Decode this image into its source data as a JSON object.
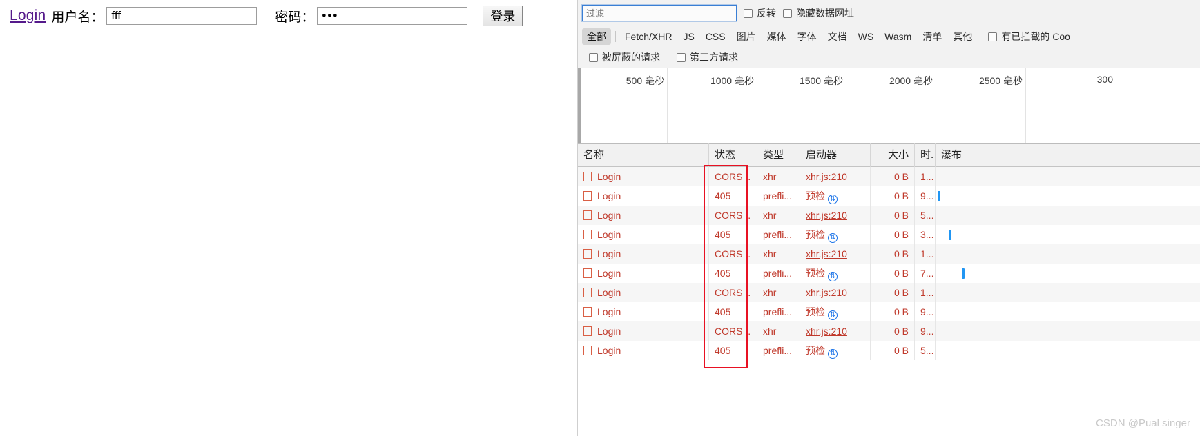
{
  "page": {
    "login_link": "Login",
    "username_label": "用户名：",
    "username_value": "fff",
    "username_placeholder": "",
    "password_label": "密码：",
    "password_value": "•••",
    "password_placeholder": "",
    "login_button": "登录"
  },
  "devtools": {
    "filter": {
      "placeholder": "过滤",
      "value": "",
      "invert_label": "反转",
      "hide_data_urls_label": "隐藏数据网址"
    },
    "type_filters": [
      {
        "label": "全部",
        "active": true
      },
      {
        "label": "Fetch/XHR",
        "active": false
      },
      {
        "label": "JS",
        "active": false
      },
      {
        "label": "CSS",
        "active": false
      },
      {
        "label": "图片",
        "active": false
      },
      {
        "label": "媒体",
        "active": false
      },
      {
        "label": "字体",
        "active": false
      },
      {
        "label": "文档",
        "active": false
      },
      {
        "label": "WS",
        "active": false
      },
      {
        "label": "Wasm",
        "active": false
      },
      {
        "label": "清单",
        "active": false
      },
      {
        "label": "其他",
        "active": false
      }
    ],
    "blocked_cookies_label": "有已拦截的 Coo",
    "blocked_requests_label": "被屏蔽的请求",
    "third_party_label": "第三方请求",
    "timeline": {
      "ticks": [
        "500 毫秒",
        "1000 毫秒",
        "1500 毫秒",
        "2000 毫秒",
        "2500 毫秒",
        "300"
      ]
    },
    "table": {
      "columns": [
        "名称",
        "状态",
        "类型",
        "启动器",
        "大小",
        "时.",
        "瀑布"
      ],
      "rows": [
        {
          "name": "Login",
          "status": "CORS ..",
          "type": "xhr",
          "initiator": "xhr.js:210",
          "initiator_link": true,
          "preflight": false,
          "size": "0 B",
          "time": "1...",
          "bar": null
        },
        {
          "name": "Login",
          "status": "405",
          "type": "prefli...",
          "initiator": "预检",
          "initiator_link": false,
          "preflight": true,
          "size": "0 B",
          "time": "9...",
          "bar": 3
        },
        {
          "name": "Login",
          "status": "CORS ..",
          "type": "xhr",
          "initiator": "xhr.js:210",
          "initiator_link": true,
          "preflight": false,
          "size": "0 B",
          "time": "5...",
          "bar": null
        },
        {
          "name": "Login",
          "status": "405",
          "type": "prefli...",
          "initiator": "预检",
          "initiator_link": false,
          "preflight": true,
          "size": "0 B",
          "time": "3...",
          "bar": 19
        },
        {
          "name": "Login",
          "status": "CORS ..",
          "type": "xhr",
          "initiator": "xhr.js:210",
          "initiator_link": true,
          "preflight": false,
          "size": "0 B",
          "time": "1...",
          "bar": null
        },
        {
          "name": "Login",
          "status": "405",
          "type": "prefli...",
          "initiator": "预检",
          "initiator_link": false,
          "preflight": true,
          "size": "0 B",
          "time": "7...",
          "bar": 38
        },
        {
          "name": "Login",
          "status": "CORS ..",
          "type": "xhr",
          "initiator": "xhr.js:210",
          "initiator_link": true,
          "preflight": false,
          "size": "0 B",
          "time": "1...",
          "bar": null
        },
        {
          "name": "Login",
          "status": "405",
          "type": "prefli...",
          "initiator": "预检",
          "initiator_link": false,
          "preflight": true,
          "size": "0 B",
          "time": "9...",
          "bar": null
        },
        {
          "name": "Login",
          "status": "CORS ..",
          "type": "xhr",
          "initiator": "xhr.js:210",
          "initiator_link": true,
          "preflight": false,
          "size": "0 B",
          "time": "9...",
          "bar": null
        },
        {
          "name": "Login",
          "status": "405",
          "type": "prefli...",
          "initiator": "预检",
          "initiator_link": false,
          "preflight": true,
          "size": "0 B",
          "time": "5...",
          "bar": null
        }
      ]
    },
    "watermark": "CSDN @Pual singer",
    "colors": {
      "error_text": "#c0392b",
      "highlight_box": "#e81123",
      "waterfall_bar": "#2196f3",
      "link": "#551a8b"
    }
  }
}
